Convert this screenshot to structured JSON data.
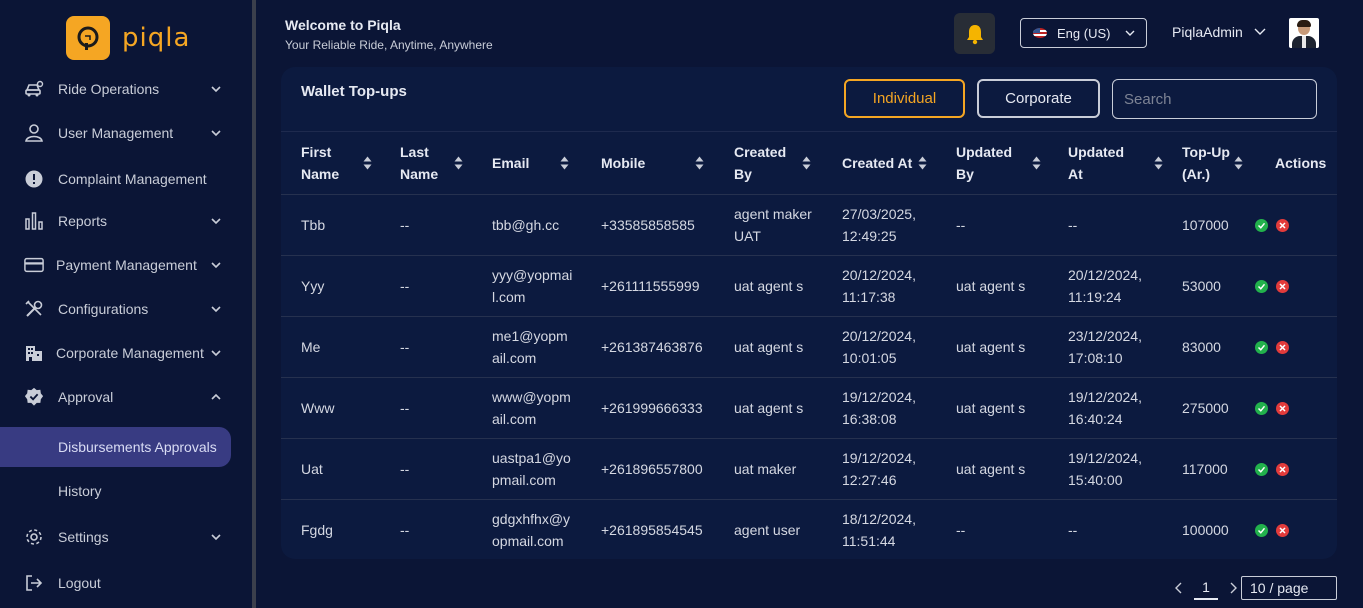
{
  "brand": {
    "name": "piqla",
    "accent": "#f5a623"
  },
  "header": {
    "title": "Welcome to Piqla",
    "subtitle": "Your Reliable Ride, Anytime, Anywhere",
    "language": "Eng (US)",
    "username": "PiqlaAdmin"
  },
  "sidebar": {
    "items": [
      {
        "label": "Ride Operations",
        "icon": "car-icon"
      },
      {
        "label": "User Management",
        "icon": "user-icon"
      },
      {
        "label": "Complaint Management",
        "icon": "alert-icon"
      },
      {
        "label": "Reports",
        "icon": "bar-chart-icon"
      },
      {
        "label": "Payment Management",
        "icon": "credit-card-icon"
      },
      {
        "label": "Configurations",
        "icon": "tools-icon"
      },
      {
        "label": "Corporate Management",
        "icon": "building-icon"
      },
      {
        "label": "Approval",
        "icon": "badge-check-icon"
      },
      {
        "label": "Disbursements Approvals",
        "icon": ""
      },
      {
        "label": "History",
        "icon": ""
      },
      {
        "label": "Settings",
        "icon": "gear-icon"
      },
      {
        "label": "Logout",
        "icon": "logout-icon"
      }
    ]
  },
  "wallet": {
    "title": "Wallet Top-ups",
    "tab_individual": "Individual",
    "tab_corporate": "Corporate",
    "search_placeholder": "Search",
    "columns": [
      {
        "line1": "First",
        "line2": "Name",
        "sortable": true
      },
      {
        "line1": "Last",
        "line2": "Name",
        "sortable": true
      },
      {
        "line1": "Email",
        "line2": "",
        "sortable": true
      },
      {
        "line1": "Mobile",
        "line2": "",
        "sortable": true
      },
      {
        "line1": "Created",
        "line2": "By",
        "sortable": true
      },
      {
        "line1": "Created At",
        "line2": "",
        "sortable": true
      },
      {
        "line1": "Updated",
        "line2": "By",
        "sortable": true
      },
      {
        "line1": "Updated",
        "line2": "At",
        "sortable": true
      },
      {
        "line1": "Top-Up",
        "line2": "(Ar.)",
        "sortable": true
      },
      {
        "line1": "Actions",
        "line2": "",
        "sortable": false
      }
    ],
    "rows": [
      {
        "first": "Tbb",
        "last": "--",
        "email1": "tbb@gh.cc",
        "email2": "",
        "mobile": "+33585858585",
        "created_by1": "agent maker",
        "created_by2": "UAT",
        "created_at1": "27/03/2025,",
        "created_at2": "12:49:25",
        "updated_by": "--",
        "updated_at1": "--",
        "updated_at2": "",
        "amount": "107000"
      },
      {
        "first": "Yyy",
        "last": "--",
        "email1": "yyy@yopmai",
        "email2": "l.com",
        "mobile": "+261111555999",
        "created_by1": "uat agent s",
        "created_by2": "",
        "created_at1": "20/12/2024,",
        "created_at2": "11:17:38",
        "updated_by": "uat agent s",
        "updated_at1": "20/12/2024,",
        "updated_at2": "11:19:24",
        "amount": "53000"
      },
      {
        "first": "Me",
        "last": "--",
        "email1": "me1@yopm",
        "email2": "ail.com",
        "mobile": "+261387463876",
        "created_by1": "uat agent s",
        "created_by2": "",
        "created_at1": "20/12/2024,",
        "created_at2": "10:01:05",
        "updated_by": "uat agent s",
        "updated_at1": "23/12/2024,",
        "updated_at2": "17:08:10",
        "amount": "83000"
      },
      {
        "first": "Www",
        "last": "--",
        "email1": "www@yopm",
        "email2": "ail.com",
        "mobile": "+261999666333",
        "created_by1": "uat agent s",
        "created_by2": "",
        "created_at1": "19/12/2024,",
        "created_at2": "16:38:08",
        "updated_by": "uat agent s",
        "updated_at1": "19/12/2024,",
        "updated_at2": "16:40:24",
        "amount": "275000"
      },
      {
        "first": "Uat",
        "last": "--",
        "email1": "uastpa1@yo",
        "email2": "pmail.com",
        "mobile": "+261896557800",
        "created_by1": "uat maker",
        "created_by2": "",
        "created_at1": "19/12/2024,",
        "created_at2": "12:27:46",
        "updated_by": "uat agent s",
        "updated_at1": "19/12/2024,",
        "updated_at2": "15:40:00",
        "amount": "117000"
      },
      {
        "first": "Fgdg",
        "last": "--",
        "email1": "gdgxhfhx@y",
        "email2": "opmail.com",
        "mobile": "+261895854545",
        "created_by1": "agent user",
        "created_by2": "",
        "created_at1": "18/12/2024,",
        "created_at2": "11:51:44",
        "updated_by": "--",
        "updated_at1": "--",
        "updated_at2": "",
        "amount": "100000"
      }
    ]
  },
  "pagination": {
    "current_page": "1",
    "page_size": "10 / page"
  }
}
